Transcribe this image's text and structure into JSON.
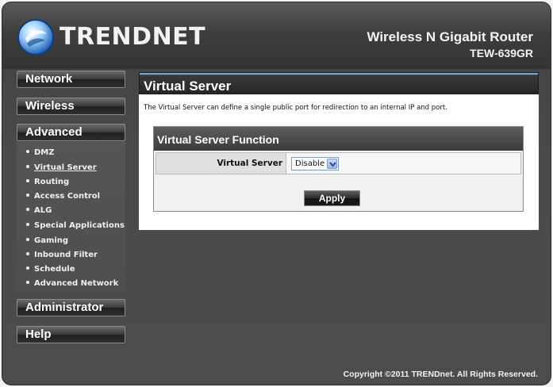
{
  "brand": {
    "logo_text": "TRENDNET",
    "product_title": "Wireless N Gigabit Router",
    "product_model": "TEW-639GR"
  },
  "sidebar": {
    "network": "Network",
    "wireless": "Wireless",
    "advanced": "Advanced",
    "submenu": [
      "DMZ",
      "Virtual Server",
      "Routing",
      "Access Control",
      "ALG",
      "Special Applications",
      "Gaming",
      "Inbound Filter",
      "Schedule",
      "Advanced Network"
    ],
    "administrator": "Administrator",
    "help": "Help"
  },
  "main": {
    "title": "Virtual Server",
    "description": "The Virtual Server can define a single public port for redirection to an internal IP and port.",
    "panel_title": "Virtual Server Function",
    "field_label": "Virtual Server",
    "select_value": "Disable",
    "apply_label": "Apply"
  },
  "footer": {
    "copyright": "Copyright ©2011 TRENDnet. All Rights Reserved."
  },
  "colors": {
    "accent_blue": "#7aa2d6",
    "bg_dark": "#4a4a4a"
  }
}
